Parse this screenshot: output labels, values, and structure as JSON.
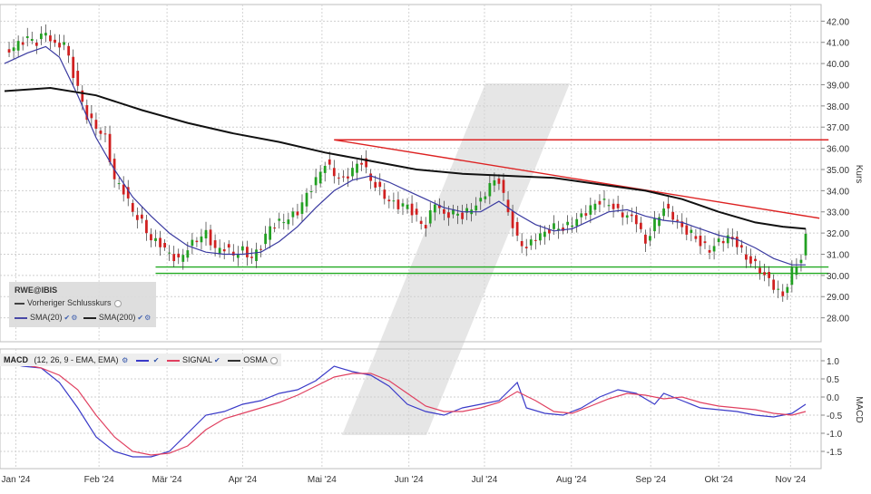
{
  "chart_data": [
    {
      "type": "candlestick",
      "title": "",
      "ylabel": "Kurs",
      "ylim": [
        27.0,
        42.4
      ],
      "y_ticks": [
        "42.00",
        "41.00",
        "40.00",
        "39.00",
        "38.00",
        "37.00",
        "36.00",
        "35.00",
        "34.00",
        "33.00",
        "32.00",
        "31.00",
        "30.00",
        "29.00",
        "28.00"
      ],
      "x_labels": [
        "Jan '24",
        "Feb '24",
        "Mär '24",
        "Apr '24",
        "Mai '24",
        "Jun '24",
        "Jul '24",
        "Aug '24",
        "Sep '24",
        "Okt '24",
        "Nov '24"
      ],
      "price_path": [
        [
          0,
          40.5
        ],
        [
          5,
          41.2
        ],
        [
          7,
          41.0
        ],
        [
          9,
          41.5
        ],
        [
          11,
          40.8
        ],
        [
          13,
          41.0
        ],
        [
          15,
          39.5
        ],
        [
          18,
          37.5
        ],
        [
          20,
          37.0
        ],
        [
          22,
          36.5
        ],
        [
          24,
          34.5
        ],
        [
          26,
          34.0
        ],
        [
          28,
          33.0
        ],
        [
          30,
          32.5
        ],
        [
          32,
          31.7
        ],
        [
          34,
          31.5
        ],
        [
          36,
          31.0
        ],
        [
          38,
          30.7
        ],
        [
          40,
          31.3
        ],
        [
          42,
          31.7
        ],
        [
          44,
          32.0
        ],
        [
          46,
          31.2
        ],
        [
          48,
          31.3
        ],
        [
          50,
          31.0
        ],
        [
          52,
          31.2
        ],
        [
          54,
          30.8
        ],
        [
          56,
          31.4
        ],
        [
          58,
          32.3
        ],
        [
          60,
          32.5
        ],
        [
          62,
          32.7
        ],
        [
          64,
          33.0
        ],
        [
          66,
          33.8
        ],
        [
          68,
          34.5
        ],
        [
          70,
          35.3
        ],
        [
          72,
          34.8
        ],
        [
          74,
          34.5
        ],
        [
          76,
          35.0
        ],
        [
          78,
          35.4
        ],
        [
          80,
          34.5
        ],
        [
          82,
          34.0
        ],
        [
          84,
          33.5
        ],
        [
          86,
          33.3
        ],
        [
          88,
          33.3
        ],
        [
          90,
          32.7
        ],
        [
          92,
          32.3
        ],
        [
          94,
          33.5
        ],
        [
          96,
          32.8
        ],
        [
          98,
          33.0
        ],
        [
          100,
          32.8
        ],
        [
          102,
          33.2
        ],
        [
          104,
          33.5
        ],
        [
          106,
          34.3
        ],
        [
          108,
          34.5
        ],
        [
          110,
          33.0
        ],
        [
          112,
          31.7
        ],
        [
          114,
          31.3
        ],
        [
          116,
          31.8
        ],
        [
          118,
          32.0
        ],
        [
          120,
          32.3
        ],
        [
          122,
          32.2
        ],
        [
          124,
          32.5
        ],
        [
          126,
          32.8
        ],
        [
          128,
          33.2
        ],
        [
          130,
          33.5
        ],
        [
          132,
          33.4
        ],
        [
          134,
          33.0
        ],
        [
          136,
          32.8
        ],
        [
          138,
          32.6
        ],
        [
          140,
          31.5
        ],
        [
          142,
          32.5
        ],
        [
          144,
          33.2
        ],
        [
          146,
          32.8
        ],
        [
          148,
          32.2
        ],
        [
          150,
          32.0
        ],
        [
          152,
          31.5
        ],
        [
          154,
          31.2
        ],
        [
          156,
          31.6
        ],
        [
          158,
          31.8
        ],
        [
          160,
          31.5
        ],
        [
          162,
          30.8
        ],
        [
          164,
          30.5
        ],
        [
          166,
          30.0
        ],
        [
          168,
          29.5
        ],
        [
          170,
          29.0
        ],
        [
          172,
          30.2
        ],
        [
          174,
          30.8
        ],
        [
          175,
          31.8
        ]
      ],
      "series": [
        {
          "name": "SMA(20)",
          "color": "#3a3aa0",
          "points": [
            [
              0,
              40.0
            ],
            [
              5,
              40.5
            ],
            [
              9,
              40.8
            ],
            [
              12,
              40.3
            ],
            [
              16,
              38.5
            ],
            [
              20,
              36.5
            ],
            [
              24,
              35.0
            ],
            [
              28,
              33.7
            ],
            [
              32,
              32.8
            ],
            [
              36,
              32.0
            ],
            [
              40,
              31.4
            ],
            [
              44,
              31.1
            ],
            [
              48,
              31.0
            ],
            [
              52,
              31.0
            ],
            [
              56,
              31.1
            ],
            [
              60,
              31.6
            ],
            [
              64,
              32.3
            ],
            [
              68,
              33.2
            ],
            [
              72,
              34.0
            ],
            [
              76,
              34.5
            ],
            [
              80,
              34.7
            ],
            [
              84,
              34.4
            ],
            [
              88,
              34.0
            ],
            [
              92,
              33.6
            ],
            [
              96,
              33.2
            ],
            [
              100,
              33.0
            ],
            [
              104,
              33.0
            ],
            [
              108,
              33.5
            ],
            [
              112,
              32.9
            ],
            [
              116,
              32.4
            ],
            [
              120,
              32.1
            ],
            [
              124,
              32.2
            ],
            [
              128,
              32.6
            ],
            [
              132,
              33.0
            ],
            [
              136,
              33.1
            ],
            [
              140,
              32.8
            ],
            [
              144,
              32.6
            ],
            [
              148,
              32.5
            ],
            [
              152,
              32.2
            ],
            [
              156,
              31.9
            ],
            [
              160,
              31.7
            ],
            [
              164,
              31.3
            ],
            [
              168,
              30.8
            ],
            [
              172,
              30.5
            ],
            [
              175,
              30.5
            ]
          ]
        },
        {
          "name": "SMA(200)",
          "color": "#111111",
          "points": [
            [
              0,
              38.7
            ],
            [
              10,
              38.85
            ],
            [
              20,
              38.5
            ],
            [
              30,
              37.8
            ],
            [
              40,
              37.2
            ],
            [
              50,
              36.7
            ],
            [
              60,
              36.3
            ],
            [
              70,
              35.8
            ],
            [
              80,
              35.4
            ],
            [
              90,
              35.0
            ],
            [
              100,
              34.8
            ],
            [
              110,
              34.7
            ],
            [
              120,
              34.6
            ],
            [
              130,
              34.3
            ],
            [
              140,
              34.0
            ],
            [
              148,
              33.6
            ],
            [
              156,
              33.0
            ],
            [
              164,
              32.5
            ],
            [
              170,
              32.3
            ],
            [
              175,
              32.2
            ]
          ]
        }
      ],
      "lines": [
        {
          "name": "resistance-trendline",
          "color": "#dd2222",
          "points": [
            [
              72,
              36.4
            ],
            [
              178,
              32.7
            ]
          ]
        },
        {
          "name": "horizontal-resistance",
          "color": "#dd2222",
          "points": [
            [
              72,
              36.4
            ],
            [
              180,
              36.4
            ]
          ]
        },
        {
          "name": "support-1",
          "color": "#22aa22",
          "points": [
            [
              33,
              30.4
            ],
            [
              180,
              30.4
            ]
          ]
        },
        {
          "name": "support-2",
          "color": "#22aa22",
          "points": [
            [
              33,
              30.1
            ],
            [
              180,
              30.1
            ]
          ]
        }
      ],
      "legend": {
        "title": "RWE@IBIS",
        "prev_close_label": "Vorheriger Schlusskurs",
        "sma20_label": "SMA(20)",
        "sma200_label": "SMA(200)"
      }
    },
    {
      "type": "line",
      "title": "",
      "ylabel": "MACD",
      "ylim": [
        -1.8,
        1.1
      ],
      "y_ticks": [
        "1.0",
        "0.5",
        "0.0",
        "-0.5",
        "-1.0",
        "-1.5"
      ],
      "series": [
        {
          "name": "MACD",
          "color": "#3a3ac8",
          "points": [
            [
              0,
              0.95
            ],
            [
              4,
              0.85
            ],
            [
              8,
              0.8
            ],
            [
              12,
              0.4
            ],
            [
              16,
              -0.3
            ],
            [
              20,
              -1.1
            ],
            [
              24,
              -1.5
            ],
            [
              28,
              -1.65
            ],
            [
              32,
              -1.65
            ],
            [
              36,
              -1.5
            ],
            [
              40,
              -1.0
            ],
            [
              44,
              -0.5
            ],
            [
              48,
              -0.4
            ],
            [
              52,
              -0.2
            ],
            [
              56,
              -0.1
            ],
            [
              60,
              0.1
            ],
            [
              64,
              0.2
            ],
            [
              68,
              0.45
            ],
            [
              72,
              0.85
            ],
            [
              76,
              0.7
            ],
            [
              80,
              0.6
            ],
            [
              84,
              0.3
            ],
            [
              88,
              -0.2
            ],
            [
              92,
              -0.4
            ],
            [
              96,
              -0.5
            ],
            [
              100,
              -0.3
            ],
            [
              104,
              -0.2
            ],
            [
              108,
              -0.1
            ],
            [
              112,
              0.4
            ],
            [
              114,
              -0.3
            ],
            [
              118,
              -0.45
            ],
            [
              122,
              -0.5
            ],
            [
              126,
              -0.3
            ],
            [
              130,
              0.0
            ],
            [
              134,
              0.2
            ],
            [
              138,
              0.1
            ],
            [
              142,
              -0.2
            ],
            [
              144,
              0.1
            ],
            [
              148,
              -0.1
            ],
            [
              152,
              -0.3
            ],
            [
              156,
              -0.35
            ],
            [
              160,
              -0.4
            ],
            [
              164,
              -0.5
            ],
            [
              168,
              -0.55
            ],
            [
              172,
              -0.45
            ],
            [
              175,
              -0.2
            ]
          ]
        },
        {
          "name": "SIGNAL",
          "color": "#e04060",
          "points": [
            [
              0,
              1.0
            ],
            [
              4,
              0.9
            ],
            [
              8,
              0.8
            ],
            [
              12,
              0.6
            ],
            [
              16,
              0.2
            ],
            [
              20,
              -0.5
            ],
            [
              24,
              -1.1
            ],
            [
              28,
              -1.5
            ],
            [
              32,
              -1.6
            ],
            [
              36,
              -1.55
            ],
            [
              40,
              -1.35
            ],
            [
              44,
              -0.9
            ],
            [
              48,
              -0.6
            ],
            [
              52,
              -0.45
            ],
            [
              56,
              -0.3
            ],
            [
              60,
              -0.15
            ],
            [
              64,
              0.05
            ],
            [
              68,
              0.3
            ],
            [
              72,
              0.55
            ],
            [
              76,
              0.65
            ],
            [
              80,
              0.65
            ],
            [
              84,
              0.45
            ],
            [
              88,
              0.1
            ],
            [
              92,
              -0.25
            ],
            [
              96,
              -0.4
            ],
            [
              100,
              -0.4
            ],
            [
              104,
              -0.3
            ],
            [
              108,
              -0.15
            ],
            [
              112,
              0.15
            ],
            [
              116,
              -0.1
            ],
            [
              120,
              -0.4
            ],
            [
              124,
              -0.45
            ],
            [
              128,
              -0.25
            ],
            [
              132,
              -0.05
            ],
            [
              136,
              0.1
            ],
            [
              140,
              0.05
            ],
            [
              144,
              -0.05
            ],
            [
              148,
              0.0
            ],
            [
              152,
              -0.15
            ],
            [
              156,
              -0.25
            ],
            [
              160,
              -0.3
            ],
            [
              164,
              -0.35
            ],
            [
              168,
              -0.45
            ],
            [
              172,
              -0.5
            ],
            [
              175,
              -0.4
            ]
          ]
        }
      ],
      "legend": {
        "title": "MACD",
        "params": "(12, 26, 9 - EMA, EMA)",
        "signal_label": "SIGNAL",
        "osma_label": "OSMA"
      }
    }
  ]
}
